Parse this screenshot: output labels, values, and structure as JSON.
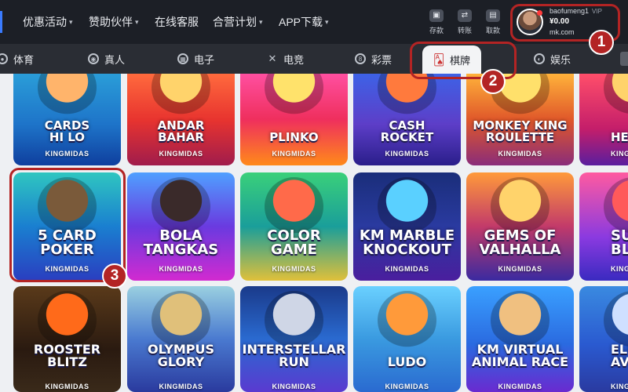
{
  "header": {
    "nav": [
      {
        "label": "优惠活动",
        "has_dropdown": true
      },
      {
        "label": "赞助伙伴",
        "has_dropdown": true
      },
      {
        "label": "在线客服",
        "has_dropdown": false
      },
      {
        "label": "合营计划",
        "has_dropdown": true
      },
      {
        "label": "APP下载",
        "has_dropdown": true
      }
    ],
    "actions": [
      {
        "label": "存款",
        "icon": "wallet-icon"
      },
      {
        "label": "转账",
        "icon": "transfer-icon"
      },
      {
        "label": "取款",
        "icon": "card-icon"
      }
    ],
    "user": {
      "username": "baofumeng1",
      "vip": "VIP",
      "balance": "¥0.00",
      "domain": "mk.com"
    }
  },
  "categories": [
    {
      "label": "体育",
      "icon": "sports-icon"
    },
    {
      "label": "真人",
      "icon": "live-casino-icon"
    },
    {
      "label": "电子",
      "icon": "slots-icon"
    },
    {
      "label": "电竞",
      "icon": "esports-icon"
    },
    {
      "label": "彩票",
      "icon": "lottery-icon"
    },
    {
      "label": "棋牌",
      "icon": "cards-icon",
      "active": true
    },
    {
      "label": "娱乐",
      "icon": "entertainment-icon"
    }
  ],
  "games": {
    "brand": "KINGMIDAS",
    "rows": [
      [
        {
          "title_lines": [
            "CARDS",
            "HI LO"
          ]
        },
        {
          "title_lines": [
            "ANDAR",
            "BAHAR"
          ]
        },
        {
          "title_lines": [
            "PLINKO"
          ]
        },
        {
          "title_lines": [
            "CASH",
            "ROCKET"
          ]
        },
        {
          "title_lines": [
            "MONKEY KING",
            "ROULETTE"
          ]
        },
        {
          "title_lines": [
            "HE"
          ]
        }
      ],
      [
        {
          "title_lines": [
            "5 CARD",
            "POKER"
          ]
        },
        {
          "title_lines": [
            "BOLA",
            "TANGKAS"
          ]
        },
        {
          "title_lines": [
            "COLOR",
            "GAME"
          ]
        },
        {
          "title_lines": [
            "KM MARBLE",
            "KNOCKOUT"
          ]
        },
        {
          "title_lines": [
            "GEMS OF",
            "VALHALLA"
          ]
        },
        {
          "title_lines": [
            "SUG",
            "BLA"
          ]
        }
      ],
      [
        {
          "title_lines": [
            "ROOSTER",
            "BLITZ"
          ]
        },
        {
          "title_lines": [
            "OLYMPUS",
            "GLORY"
          ]
        },
        {
          "title_lines": [
            "INTERSTELLAR",
            "RUN"
          ]
        },
        {
          "title_lines": [
            "LUDO"
          ]
        },
        {
          "title_lines": [
            "KM VIRTUAL",
            "ANIMAL RACE"
          ]
        },
        {
          "title_lines": [
            "ELITE AV"
          ]
        }
      ]
    ]
  },
  "annotations": [
    {
      "number": "1",
      "target": "user-profile"
    },
    {
      "number": "2",
      "target": "category-cards"
    },
    {
      "number": "3",
      "target": "game-5-card-poker"
    }
  ],
  "colors": {
    "accent": "#b32424",
    "topbar": "#1c1f26",
    "catbar": "#2a2d34"
  }
}
